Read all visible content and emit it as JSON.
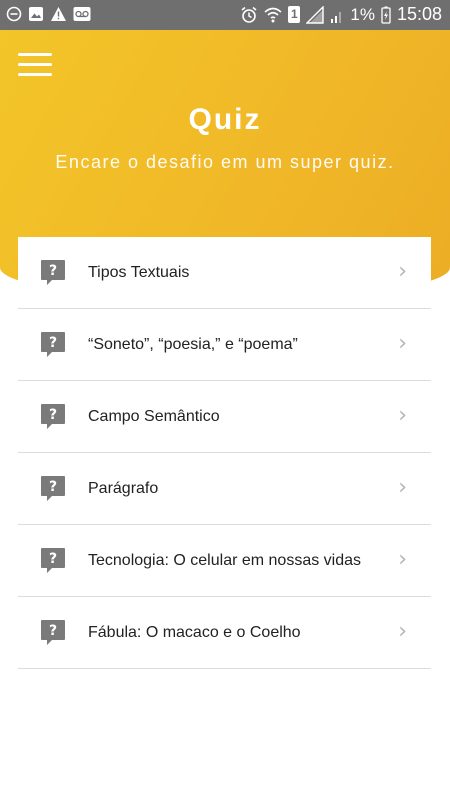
{
  "status_bar": {
    "battery_percent": "1%",
    "time": "15:08",
    "sim_slot": "1"
  },
  "header": {
    "title": "Quiz",
    "subtitle": "Encare o desafio em um super quiz.",
    "accent_color": "#F2BE28"
  },
  "quiz_list": [
    {
      "label": "Tipos Textuais",
      "icon": "question-bubble-icon"
    },
    {
      "label": "“Soneto”, “poesia,” e “poema”",
      "icon": "question-bubble-icon"
    },
    {
      "label": "Campo Semântico",
      "icon": "question-bubble-icon"
    },
    {
      "label": "Parágrafo",
      "icon": "question-bubble-icon"
    },
    {
      "label": "Tecnologia: O celular em nossas vidas",
      "icon": "question-bubble-icon"
    },
    {
      "label": "Fábula: O macaco e o Coelho",
      "icon": "question-bubble-icon"
    }
  ]
}
